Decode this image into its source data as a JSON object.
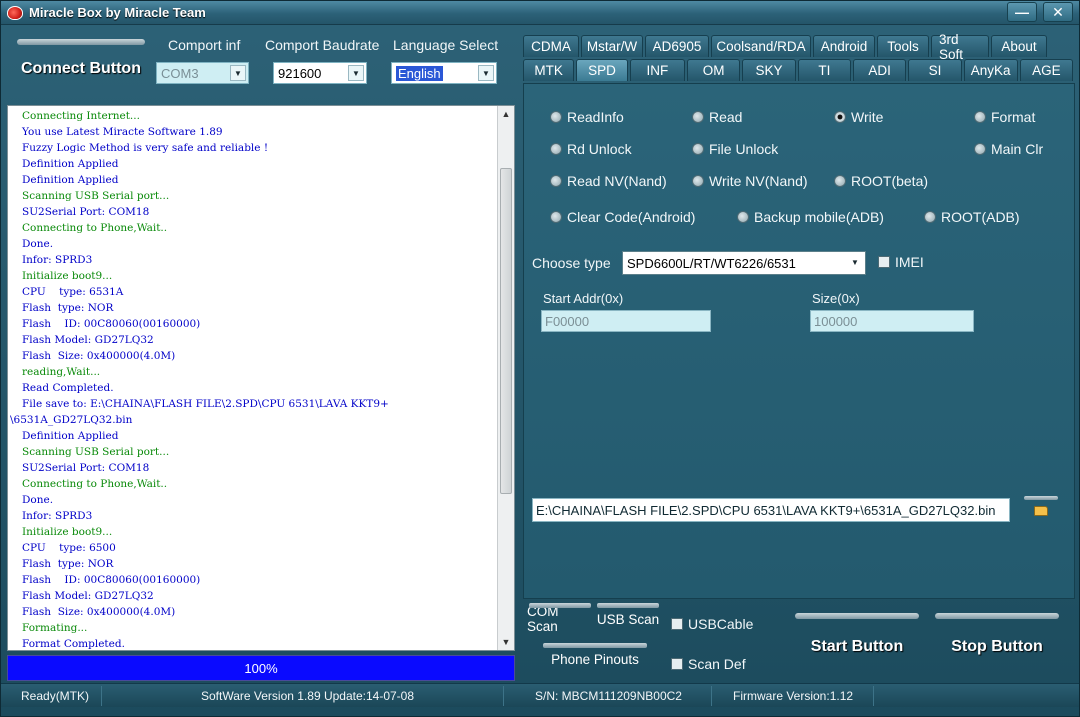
{
  "window": {
    "title": "Miracle Box by Miracle Team",
    "minimize": "—",
    "close": "✕"
  },
  "connect": {
    "label": "Connect Button"
  },
  "comport": {
    "label": "Comport inf",
    "value": "COM3"
  },
  "baud": {
    "label": "Comport Baudrate",
    "value": "921600"
  },
  "language": {
    "label": "Language Select",
    "value": "English"
  },
  "log": {
    "lines": [
      {
        "t": "Connecting Internet...",
        "c": "#0a8a0a"
      },
      {
        "t": "You use Latest Miracte Software 1.89",
        "c": "#0000c8"
      },
      {
        "t": "Fuzzy Logic Method is very safe and reliable !",
        "c": "#0000c8"
      },
      {
        "t": "Definition Applied",
        "c": "#0000c8"
      },
      {
        "t": "Definition Applied",
        "c": "#0000c8"
      },
      {
        "t": "Scanning USB Serial port...",
        "c": "#0a8a0a"
      },
      {
        "t": "SU2Serial Port: COM18",
        "c": "#0000c8"
      },
      {
        "t": "Connecting to Phone,Wait..",
        "c": "#0a8a0a"
      },
      {
        "t": "Done.",
        "c": "#0000c8"
      },
      {
        "t": "Infor: SPRD3",
        "c": "#0000c8"
      },
      {
        "t": "Initialize boot9...",
        "c": "#0a8a0a"
      },
      {
        "t": "CPU    type: 6531A",
        "c": "#0000c8"
      },
      {
        "t": "Flash  type: NOR",
        "c": "#0000c8"
      },
      {
        "t": "Flash    ID: 00C80060(00160000)",
        "c": "#0000c8"
      },
      {
        "t": "Flash Model: GD27LQ32",
        "c": "#0000c8"
      },
      {
        "t": "Flash  Size: 0x400000(4.0M)",
        "c": "#0000c8"
      },
      {
        "t": "reading,Wait...",
        "c": "#0a8a0a"
      },
      {
        "t": "Read Completed.",
        "c": "#0000c8"
      },
      {
        "t": "File save to: E:\\CHAINA\\FLASH FILE\\2.SPD\\CPU 6531\\LAVA KKT9+",
        "c": "#0000c8"
      },
      {
        "t": "\\6531A_GD27LQ32.bin",
        "c": "#0000c8",
        "indent": true
      },
      {
        "t": "Definition Applied",
        "c": "#0000c8"
      },
      {
        "t": "Scanning USB Serial port...",
        "c": "#0a8a0a"
      },
      {
        "t": "SU2Serial Port: COM18",
        "c": "#0000c8"
      },
      {
        "t": "Connecting to Phone,Wait..",
        "c": "#0a8a0a"
      },
      {
        "t": "Done.",
        "c": "#0000c8"
      },
      {
        "t": "Infor: SPRD3",
        "c": "#0000c8"
      },
      {
        "t": "Initialize boot9...",
        "c": "#0a8a0a"
      },
      {
        "t": "CPU    type: 6500",
        "c": "#0000c8"
      },
      {
        "t": "Flash  type: NOR",
        "c": "#0000c8"
      },
      {
        "t": "Flash    ID: 00C80060(00160000)",
        "c": "#0000c8"
      },
      {
        "t": "Flash Model: GD27LQ32",
        "c": "#0000c8"
      },
      {
        "t": "Flash  Size: 0x400000(4.0M)",
        "c": "#0000c8"
      },
      {
        "t": "Formating...",
        "c": "#0a8a0a"
      },
      {
        "t": "Format Completed.",
        "c": "#0000c8"
      }
    ]
  },
  "progress": {
    "label": "100%",
    "value": 100
  },
  "tabs": {
    "row1": [
      "CDMA",
      "Mstar/W",
      "AD6905",
      "Coolsand/RDA",
      "Android",
      "Tools",
      "3rd Soft",
      "About"
    ],
    "row2": [
      "MTK",
      "SPD",
      "INF",
      "OM",
      "SKY",
      "TI",
      "ADI",
      "SI",
      "AnyKa",
      "AGE"
    ],
    "active": "SPD"
  },
  "options": {
    "readinfo": "ReadInfo",
    "read": "Read",
    "write": "Write",
    "format": "Format",
    "rd_unlock": "Rd Unlock",
    "file_unlock": "File Unlock",
    "main_clr": "Main Clr",
    "read_nv": "Read NV(Nand)",
    "write_nv": "Write NV(Nand)",
    "root_beta": "ROOT(beta)",
    "clear_code": "Clear Code(Android)",
    "backup_mobile": "Backup mobile(ADB)",
    "root_adb": "ROOT(ADB)",
    "selected": "Write"
  },
  "choose_type": {
    "label": "Choose  type",
    "value": "SPD6600L/RT/WT6226/6531"
  },
  "imei": {
    "label": "IMEI"
  },
  "start_addr": {
    "label": "Start Addr(0x)",
    "value": "F00000"
  },
  "size": {
    "label": "Size(0x)",
    "value": "100000"
  },
  "file_path": {
    "value": "E:\\CHAINA\\FLASH FILE\\2.SPD\\CPU 6531\\LAVA KKT9+\\6531A_GD27LQ32.bin"
  },
  "bottom": {
    "com_scan": "COM Scan",
    "usb_scan": "USB Scan",
    "usb_cable": "USBCable",
    "phone_pinouts": "Phone Pinouts",
    "scan_def": "Scan Def",
    "start": "Start Button",
    "stop": "Stop Button"
  },
  "status": {
    "mode": "Ready(MTK)",
    "version": "SoftWare Version 1.89  Update:14-07-08",
    "serial": "S/N: MBCM111209NB00C2",
    "firmware": "Firmware Version:1.12"
  }
}
